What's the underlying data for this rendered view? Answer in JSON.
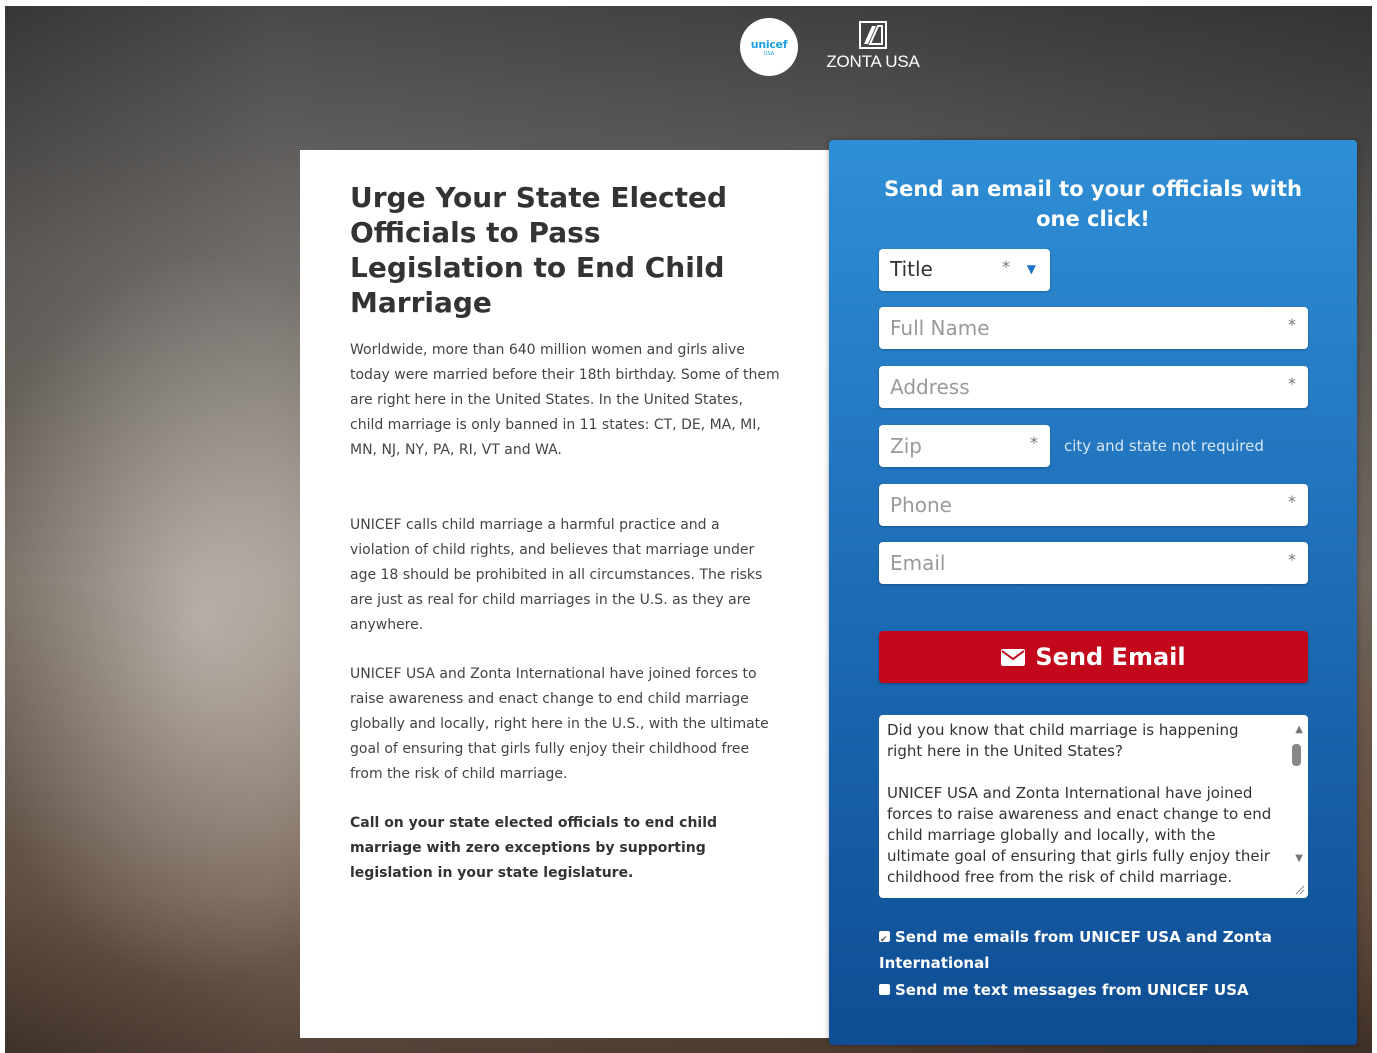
{
  "logos": {
    "unicef_word": "unicef",
    "unicef_sub": "USA",
    "zonta_word": "ZONTA USA"
  },
  "info": {
    "title": "Urge Your State Elected Officials to Pass Legislation to End Child Marriage",
    "para1": "Worldwide, more than 640 million women and girls alive today were married before their 18th birthday. Some of them are right here in the United States. In the United States, child marriage is only banned in 11 states: CT, DE, MA, MI, MN, NJ, NY, PA, RI, VT and WA.",
    "para2": "UNICEF calls child marriage a harmful practice and a violation of child rights, and believes that marriage under age 18 should be prohibited in all circumstances. The risks are just as real for child marriages in the U.S. as they are anywhere.",
    "para3": "UNICEF USA and Zonta International have joined forces to raise awareness and enact change to end child marriage globally and locally, right here in the U.S., with the ultimate goal of ensuring that girls fully enjoy their childhood free from the risk of child marriage.",
    "para4": "Call on your state elected officials to end child marriage with zero exceptions by supporting legislation in your state legislature."
  },
  "form": {
    "heading": "Send an email to your officials with one click!",
    "title_value": "Title",
    "required_mark": "*",
    "full_name_placeholder": "Full Name",
    "address_placeholder": "Address",
    "zip_placeholder": "Zip",
    "zip_note": "city and state not required",
    "phone_placeholder": "Phone",
    "email_placeholder": "Email",
    "send_label": "Send Email",
    "message": "Did you know that child marriage is happening right here in the United States?\n\nUNICEF USA and Zonta International have joined forces to raise awareness and enact change to end child marriage globally and locally, with the ultimate goal of ensuring that girls fully enjoy their childhood free from the risk of child marriage.",
    "opt_in_emails": "Send me emails from UNICEF USA and Zonta International",
    "opt_in_emails_checked": true,
    "opt_in_texts": "Send me text messages from UNICEF USA",
    "opt_in_texts_checked": false
  },
  "colors": {
    "form_blue": "#1f6fb9",
    "send_red": "#c2081a",
    "unicef_blue": "#1ca0dd"
  }
}
